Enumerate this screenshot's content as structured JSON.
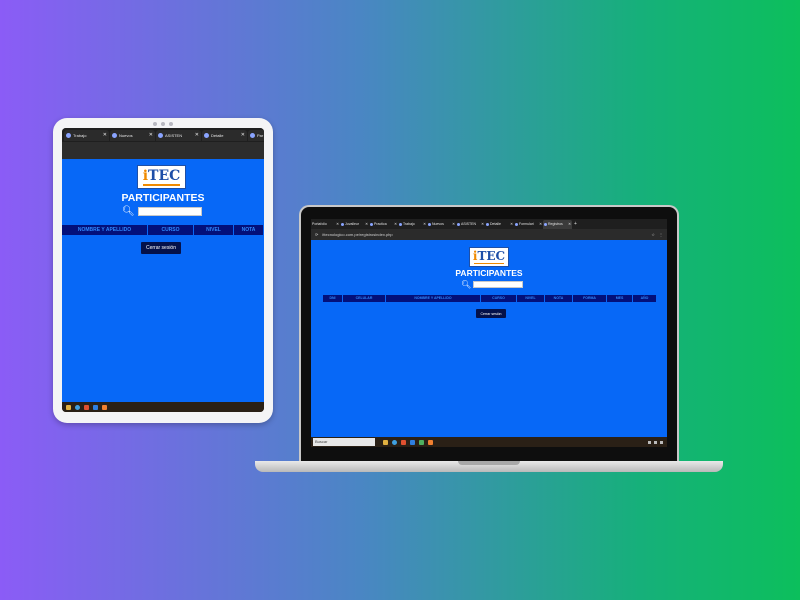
{
  "tablet": {
    "tabs": [
      {
        "label": "Trabajo"
      },
      {
        "label": "Nuevos"
      },
      {
        "label": "ASISTEN"
      },
      {
        "label": "Detalle"
      },
      {
        "label": "Par"
      }
    ],
    "page": {
      "logo": "iTEC",
      "title": "PARTICIPANTES",
      "search": {
        "placeholder": ""
      },
      "columns": [
        "NOMBRE Y APELLIDO",
        "CURSO",
        "NIVEL",
        "NOTA"
      ],
      "logout_label": "Cerrar sesión"
    }
  },
  "laptop": {
    "tabs": [
      {
        "label": "Portafolio"
      },
      {
        "label": "Juvalleur"
      },
      {
        "label": "Practica"
      },
      {
        "label": "Trabajo"
      },
      {
        "label": "Nuevos"
      },
      {
        "label": "ASISTEN"
      },
      {
        "label": "Detalle"
      },
      {
        "label": "Formulari"
      },
      {
        "label": "Registros"
      }
    ],
    "address": "ittecnologico.com.pe/registrosindex.php",
    "page": {
      "logo": "iTEC",
      "title": "PARTICIPANTES",
      "search": {
        "placeholder": ""
      },
      "columns": [
        "DNI",
        "CELULAR",
        "NOMBRE Y APELLIDO",
        "CURSO",
        "NIVEL",
        "NOTA",
        "FORMA",
        "MES",
        "AÑO"
      ],
      "logout_label": "Cerrar sesión"
    },
    "taskbar": {
      "search_label": "Buscar"
    }
  },
  "colors": {
    "page_bg": "#0768f7",
    "header_bg": "#03107a",
    "header_text": "#2e8bff",
    "button_bg": "#04114a"
  }
}
